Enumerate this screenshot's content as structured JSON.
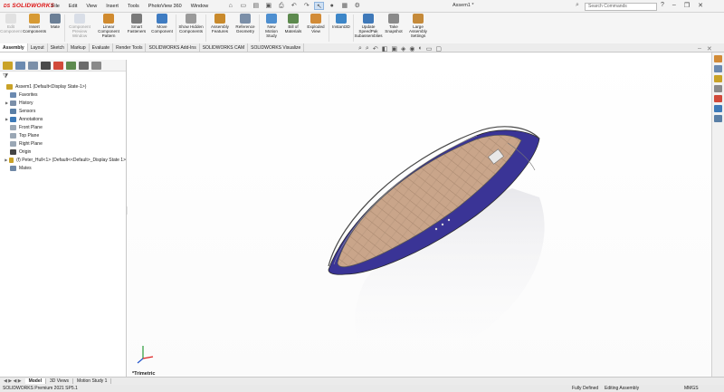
{
  "app": {
    "logo_text": "SOLIDWORKS",
    "document_title": "Assem1 *",
    "search_placeholder": "Search Commands"
  },
  "menus": [
    "File",
    "Edit",
    "View",
    "Insert",
    "Tools",
    "PhotoView 360",
    "Window"
  ],
  "ribbon": [
    {
      "label": "Edit Component",
      "enabled": false,
      "color": "#c9c9c9"
    },
    {
      "label": "Insert Components",
      "enabled": true,
      "color": "#d79a34"
    },
    {
      "label": "Mate",
      "enabled": true,
      "color": "#6b7f96"
    },
    {
      "label": "Component Preview Window",
      "enabled": false,
      "color": "#b7c4d6"
    },
    {
      "label": "Linear Component Pattern",
      "enabled": true,
      "color": "#d08a2e"
    },
    {
      "label": "Smart Fasteners",
      "enabled": true,
      "color": "#7a7a7a"
    },
    {
      "label": "Move Component",
      "enabled": true,
      "color": "#3f7cc2"
    },
    {
      "label": "Show Hidden Components",
      "enabled": true,
      "color": "#9a9a9a"
    },
    {
      "label": "Assembly Features",
      "enabled": true,
      "color": "#c98a2c"
    },
    {
      "label": "Reference Geometry",
      "enabled": true,
      "color": "#7b8fa8"
    },
    {
      "label": "New Motion Study",
      "enabled": true,
      "color": "#4e8fd0"
    },
    {
      "label": "Bill of Materials",
      "enabled": true,
      "color": "#5d8a4e"
    },
    {
      "label": "Exploded View",
      "enabled": true,
      "color": "#d28b37"
    },
    {
      "label": "Instant3D",
      "enabled": true,
      "color": "#3d86c8"
    },
    {
      "label": "Update SpeedPak Subassemblies",
      "enabled": true,
      "color": "#3f79b9"
    },
    {
      "label": "Take Snapshot",
      "enabled": true,
      "color": "#8a8a8a"
    },
    {
      "label": "Large Assembly Settings",
      "enabled": true,
      "color": "#c58a3a"
    }
  ],
  "command_tabs": [
    "Assembly",
    "Layout",
    "Sketch",
    "Markup",
    "Evaluate",
    "Render Tools",
    "SOLIDWORKS Add-Ins",
    "SOLIDWORKS CAM",
    "SOLIDWORKS Visualize"
  ],
  "tree": [
    {
      "label": "Assem1  (Default<Display State-1>)",
      "icon": "assembly-icon",
      "color": "#c9a227",
      "expander": ""
    },
    {
      "label": "Favorites",
      "icon": "favorites-icon",
      "color": "#6b8ab0",
      "expander": ""
    },
    {
      "label": "History",
      "icon": "history-icon",
      "color": "#7b8fa8",
      "expander": "▶"
    },
    {
      "label": "Sensors",
      "icon": "sensors-icon",
      "color": "#5a7fa6",
      "expander": ""
    },
    {
      "label": "Annotations",
      "icon": "annotations-icon",
      "color": "#3d7ab8",
      "expander": "▶"
    },
    {
      "label": "Front Plane",
      "icon": "plane-icon",
      "color": "#9aa7b5",
      "expander": ""
    },
    {
      "label": "Top Plane",
      "icon": "plane-icon",
      "color": "#9aa7b5",
      "expander": ""
    },
    {
      "label": "Right Plane",
      "icon": "plane-icon",
      "color": "#9aa7b5",
      "expander": ""
    },
    {
      "label": "Origin",
      "icon": "origin-icon",
      "color": "#444444",
      "expander": ""
    },
    {
      "label": "(f) Peter_Hull<1> (Default<<Default>_Display State 1>",
      "icon": "part-icon",
      "color": "#c9a227",
      "expander": "▶"
    },
    {
      "label": "Mates",
      "icon": "mates-icon",
      "color": "#6f88a6",
      "expander": ""
    }
  ],
  "viewport": {
    "view_label": "*Trimetric",
    "hull_color": "#3a3496",
    "deck_color": "#c9a58a"
  },
  "bottom_tabs": [
    "Model",
    "3D Views",
    "Motion Study 1"
  ],
  "status": {
    "product": "SOLIDWORKS Premium 2021 SP5.1",
    "state": "Fully Defined",
    "mode": "Editing Assembly",
    "units": "MMGS"
  }
}
